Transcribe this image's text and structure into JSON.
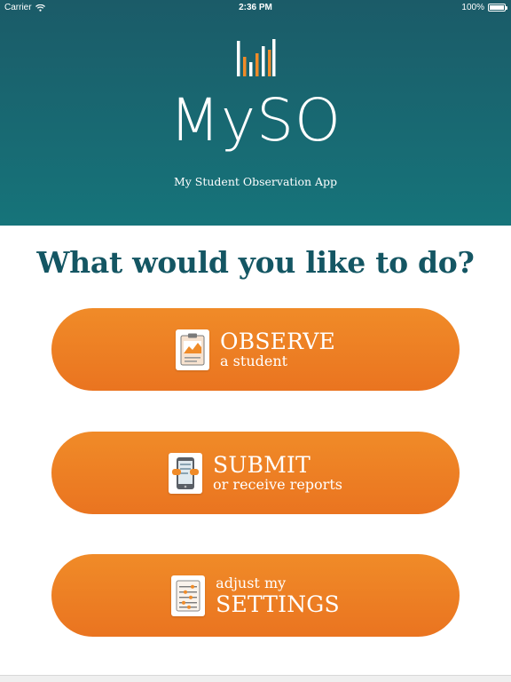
{
  "status_bar": {
    "carrier": "Carrier",
    "time": "2:36 PM",
    "battery": "100%",
    "battery_level": 1.0
  },
  "header": {
    "title": "MySO",
    "subtitle": "My Student Observation App",
    "logo_icon": "bar-chart-logo-icon"
  },
  "prompt": "What would you like to do?",
  "actions": [
    {
      "id": "observe",
      "main": "OBSERVE",
      "sub": "a student",
      "icon": "clipboard-chart-icon"
    },
    {
      "id": "submit",
      "main": "SUBMIT",
      "sub": "or receive reports",
      "icon": "tablet-report-icon"
    },
    {
      "id": "settings",
      "pre": "adjust my",
      "main": "SETTINGS",
      "icon": "settings-sliders-icon"
    }
  ],
  "colors": {
    "header_top": "#1b5b68",
    "header_bottom": "#16747a",
    "accent_orange": "#ee7f24",
    "question_text": "#145663"
  }
}
